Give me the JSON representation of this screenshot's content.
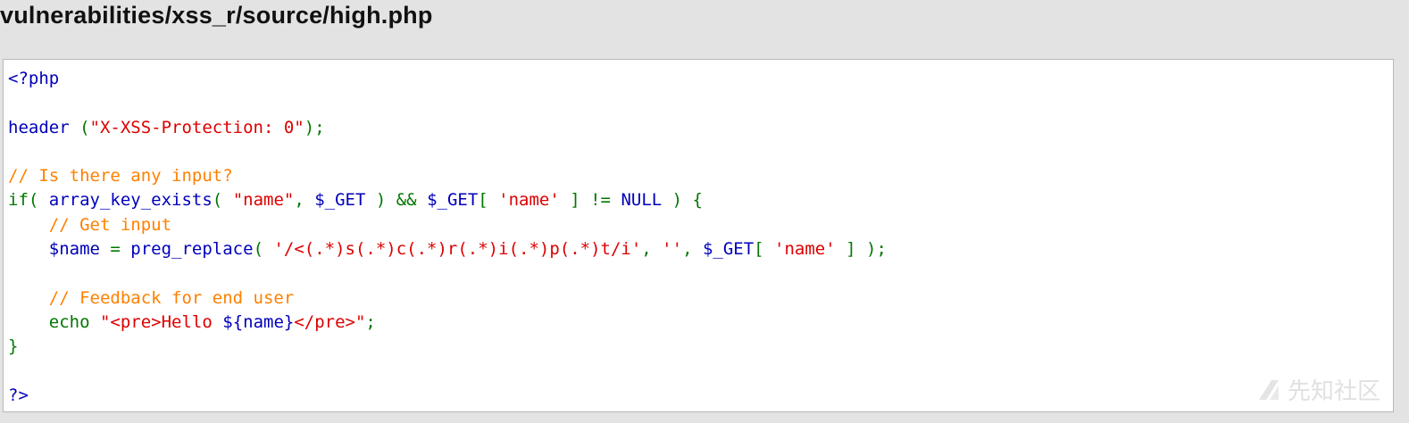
{
  "header": {
    "title": "vulnerabilities/xss_r/source/high.php"
  },
  "colors": {
    "keyword": "#007700",
    "default": "#0000bb",
    "string": "#dd0000",
    "comment": "#ff8000",
    "html": "#000000",
    "background": "#e3e3e3",
    "code_background": "#ffffff"
  },
  "code": {
    "lines": [
      [
        {
          "t": "<?php",
          "c": "default"
        }
      ],
      [],
      [
        {
          "t": "header",
          "c": "default"
        },
        {
          "t": " (",
          "c": "keyword"
        },
        {
          "t": "\"X-XSS-Protection: 0\"",
          "c": "string"
        },
        {
          "t": ");",
          "c": "keyword"
        }
      ],
      [],
      [
        {
          "t": "// Is there any input?",
          "c": "comment"
        }
      ],
      [
        {
          "t": "if( ",
          "c": "keyword"
        },
        {
          "t": "array_key_exists",
          "c": "default"
        },
        {
          "t": "( ",
          "c": "keyword"
        },
        {
          "t": "\"name\"",
          "c": "string"
        },
        {
          "t": ", ",
          "c": "keyword"
        },
        {
          "t": "$_GET",
          "c": "default"
        },
        {
          "t": " ) && ",
          "c": "keyword"
        },
        {
          "t": "$_GET",
          "c": "default"
        },
        {
          "t": "[ ",
          "c": "keyword"
        },
        {
          "t": "'name'",
          "c": "string"
        },
        {
          "t": " ] != ",
          "c": "keyword"
        },
        {
          "t": "NULL",
          "c": "default"
        },
        {
          "t": " ) {",
          "c": "keyword"
        }
      ],
      [
        {
          "t": "    ",
          "c": "keyword"
        },
        {
          "t": "// Get input",
          "c": "comment"
        }
      ],
      [
        {
          "t": "    ",
          "c": "keyword"
        },
        {
          "t": "$name",
          "c": "default"
        },
        {
          "t": " = ",
          "c": "keyword"
        },
        {
          "t": "preg_replace",
          "c": "default"
        },
        {
          "t": "( ",
          "c": "keyword"
        },
        {
          "t": "'/<(.*)s(.*)c(.*)r(.*)i(.*)p(.*)t/i'",
          "c": "string"
        },
        {
          "t": ", ",
          "c": "keyword"
        },
        {
          "t": "''",
          "c": "string"
        },
        {
          "t": ", ",
          "c": "keyword"
        },
        {
          "t": "$_GET",
          "c": "default"
        },
        {
          "t": "[ ",
          "c": "keyword"
        },
        {
          "t": "'name'",
          "c": "string"
        },
        {
          "t": " ] );",
          "c": "keyword"
        }
      ],
      [],
      [
        {
          "t": "    ",
          "c": "keyword"
        },
        {
          "t": "// Feedback for end user",
          "c": "comment"
        }
      ],
      [
        {
          "t": "    ",
          "c": "keyword"
        },
        {
          "t": "echo ",
          "c": "keyword"
        },
        {
          "t": "\"<pre>Hello ",
          "c": "string"
        },
        {
          "t": "${name}",
          "c": "default"
        },
        {
          "t": "</pre>\"",
          "c": "string"
        },
        {
          "t": ";",
          "c": "keyword"
        }
      ],
      [
        {
          "t": "}",
          "c": "keyword"
        }
      ],
      [],
      [
        {
          "t": "?>",
          "c": "default"
        }
      ]
    ]
  },
  "watermark": {
    "text": "先知社区",
    "icon": "xianzhi-logo-icon"
  }
}
